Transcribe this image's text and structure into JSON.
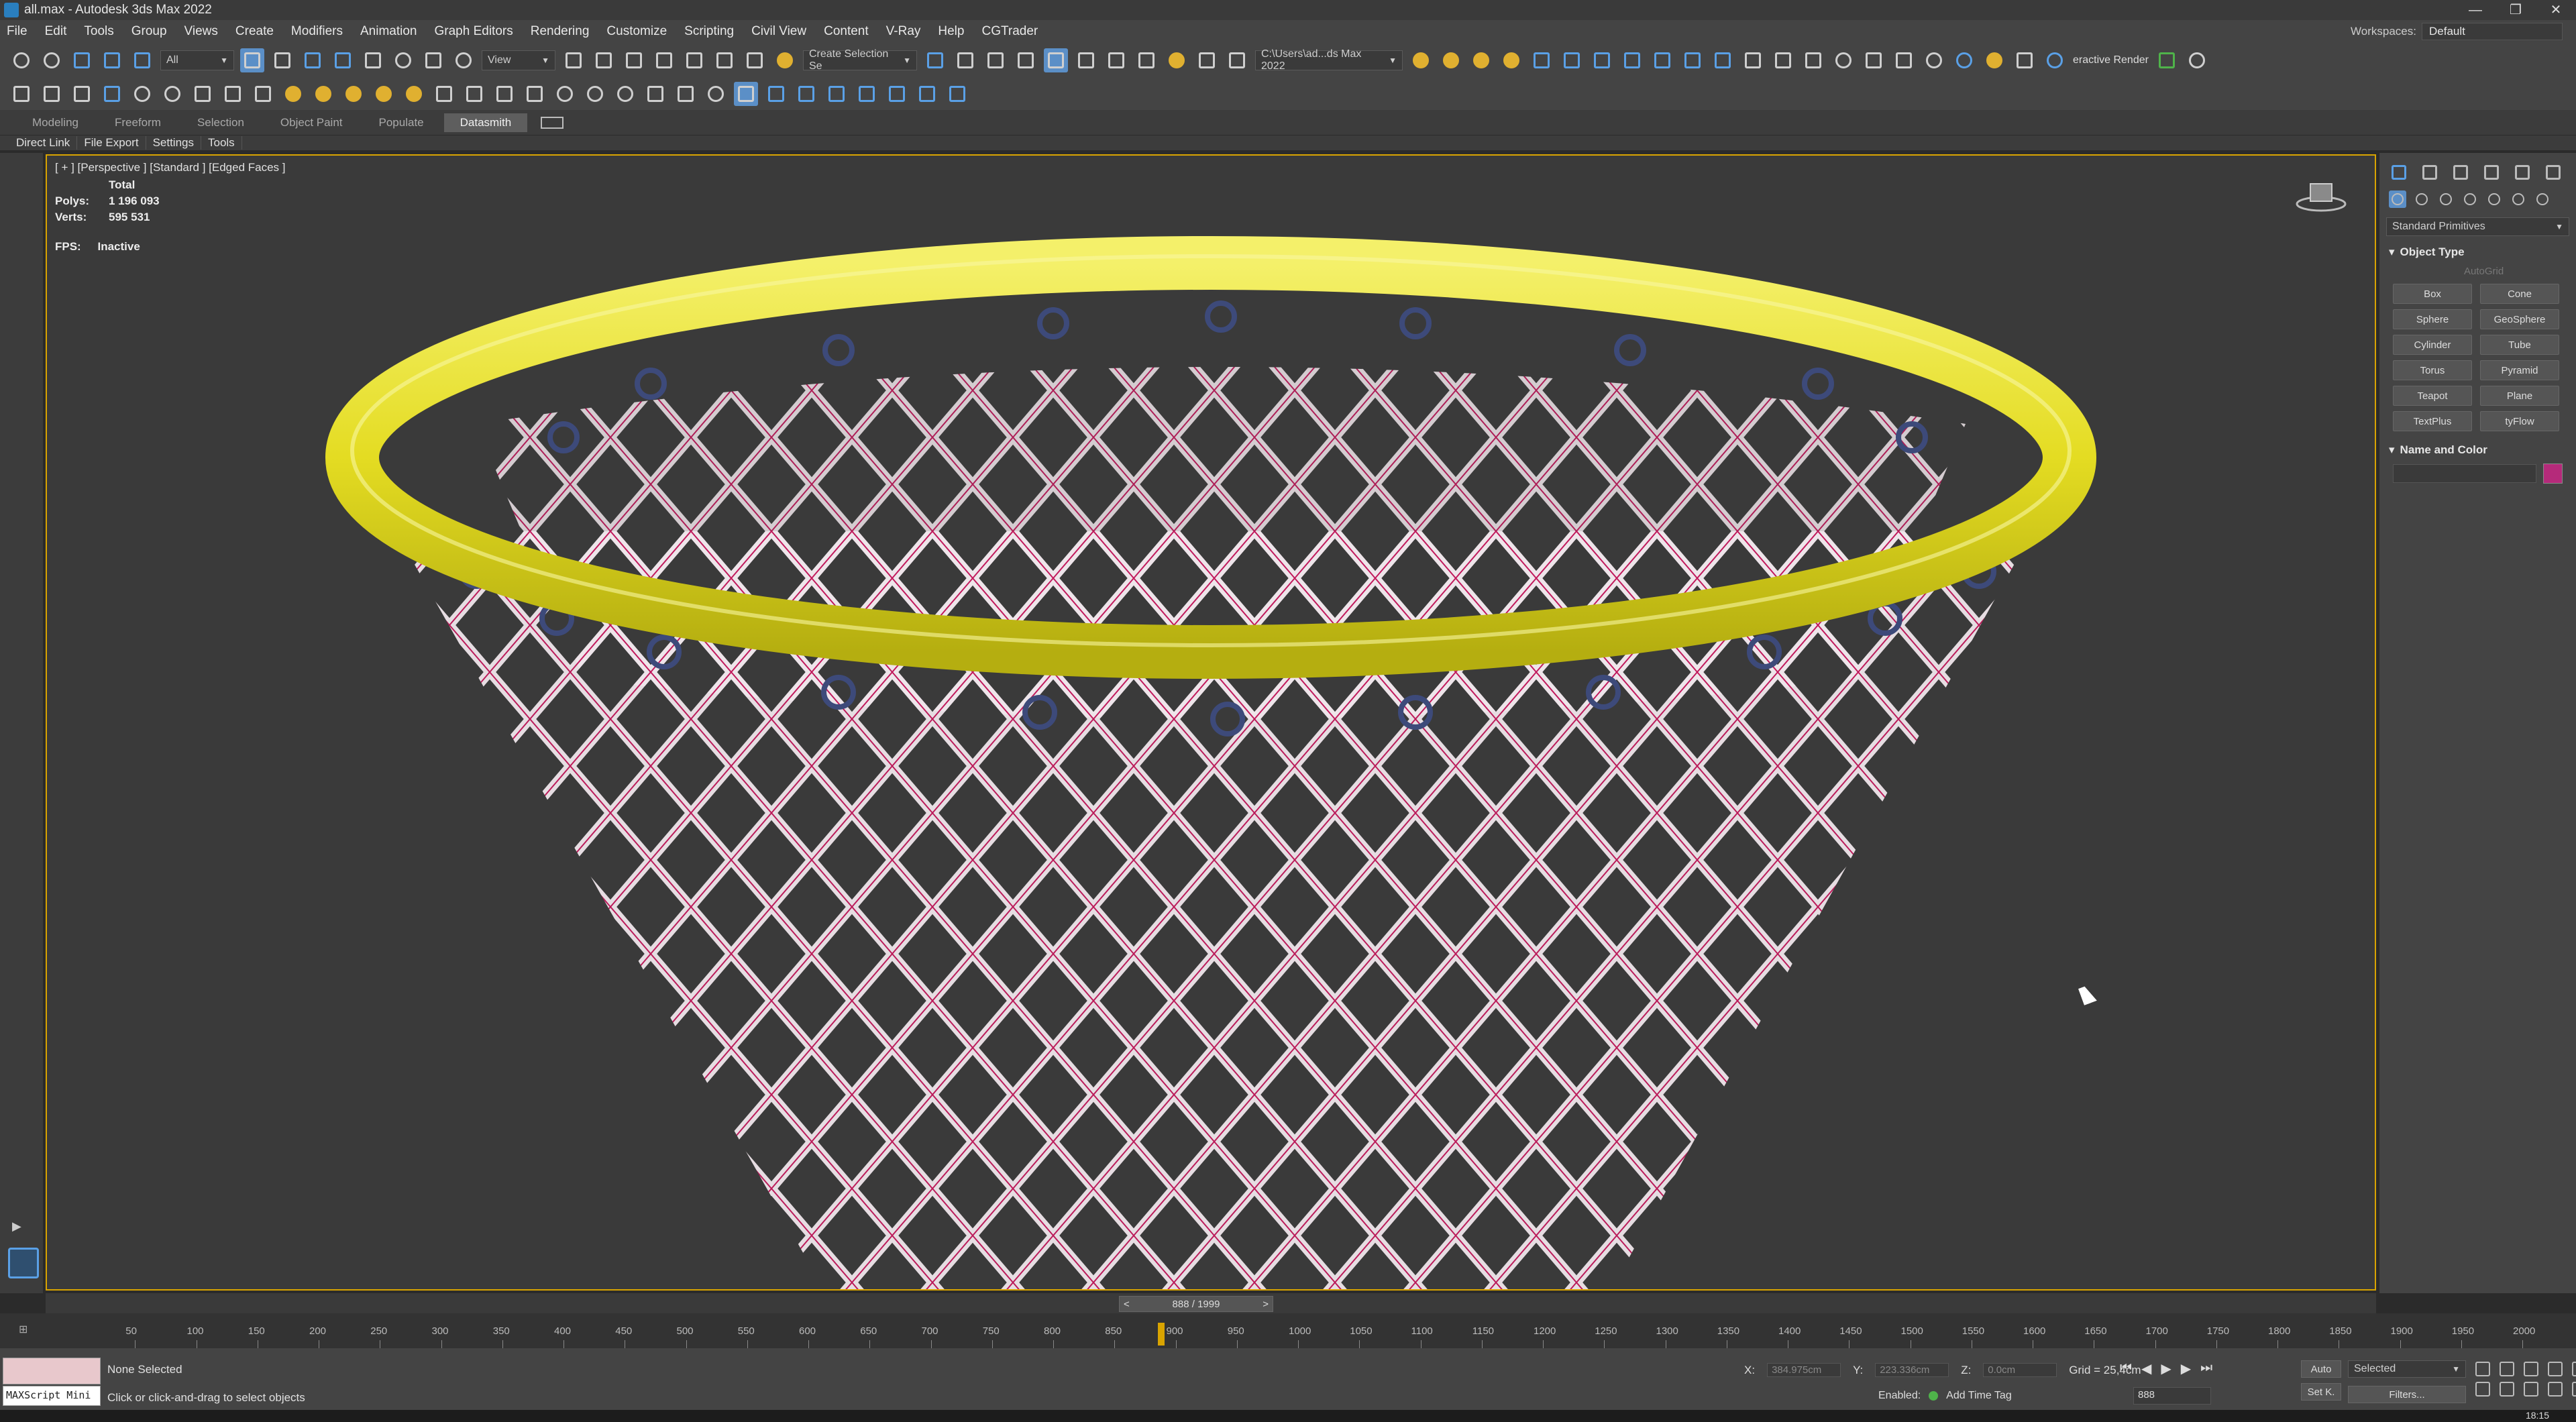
{
  "window": {
    "title": "all.max - Autodesk 3ds Max 2022",
    "minimize": "—",
    "restore": "❐",
    "close": "✕"
  },
  "menu": [
    "File",
    "Edit",
    "Tools",
    "Group",
    "Views",
    "Create",
    "Modifiers",
    "Animation",
    "Graph Editors",
    "Rendering",
    "Customize",
    "Scripting",
    "Civil View",
    "Content",
    "V-Ray",
    "Help",
    "CGTrader"
  ],
  "workspace": {
    "label": "Workspaces:",
    "value": "Default"
  },
  "toolbar": {
    "filter_value": "All",
    "view_value": "View",
    "selection_set_placeholder": "Create Selection Se",
    "project_path": "C:\\Users\\ad...ds Max 2022",
    "interactive_render": "eractive Render"
  },
  "ribbon": {
    "tabs": [
      "Modeling",
      "Freeform",
      "Selection",
      "Object Paint",
      "Populate",
      "Datasmith"
    ],
    "active_tab": "Datasmith",
    "subtabs": [
      "Direct Link",
      "File Export",
      "Settings",
      "Tools"
    ]
  },
  "viewport": {
    "label": "[ + ] [Perspective ] [Standard ] [Edged Faces ]",
    "stats_title": "Total",
    "polys_label": "Polys:",
    "polys_value": "1 196 093",
    "verts_label": "Verts:",
    "verts_value": "595 531",
    "fps_label": "FPS:",
    "fps_value": "Inactive",
    "rim_color": "#e6e02a",
    "net_color": "#e8dde3",
    "wire_color": "#c2185b"
  },
  "command_panel": {
    "category": "Standard Primitives",
    "object_type_title": "Object Type",
    "autogrid": "AutoGrid",
    "buttons": [
      "Box",
      "Cone",
      "Sphere",
      "GeoSphere",
      "Cylinder",
      "Tube",
      "Torus",
      "Pyramid",
      "Teapot",
      "Plane",
      "TextPlus",
      "tyFlow"
    ],
    "name_color_title": "Name and Color",
    "swatch_color": "#b52a7a"
  },
  "timeline": {
    "frame_display": "888 / 1999",
    "prev": "<",
    "next": ">",
    "ticks": [
      "50",
      "100",
      "150",
      "200",
      "250",
      "300",
      "350",
      "400",
      "450",
      "500",
      "550",
      "600",
      "650",
      "700",
      "750",
      "800",
      "850",
      "900",
      "950",
      "1000",
      "1050",
      "1100",
      "1150",
      "1200",
      "1250",
      "1300",
      "1350",
      "1400",
      "1450",
      "1500",
      "1550",
      "1600",
      "1650",
      "1700",
      "1750",
      "1800",
      "1850",
      "1900",
      "1950",
      "2000"
    ],
    "current_frame": 888,
    "total_frames": 2000
  },
  "status": {
    "maxscript": "MAXScript Mini",
    "selection": "None Selected",
    "prompt": "Click or click-and-drag to select objects",
    "x_label": "X:",
    "x_value": "384.975cm",
    "y_label": "Y:",
    "y_value": "223.336cm",
    "z_label": "Z:",
    "z_value": "0.0cm",
    "grid": "Grid = 25,4cm",
    "enabled": "Enabled:",
    "add_time_tag": "Add Time Tag",
    "frame_field": "888",
    "auto": "Auto",
    "setk": "Set K.",
    "selected": "Selected",
    "filters": "Filters..."
  },
  "taskbar": {
    "clock": "18:15"
  }
}
